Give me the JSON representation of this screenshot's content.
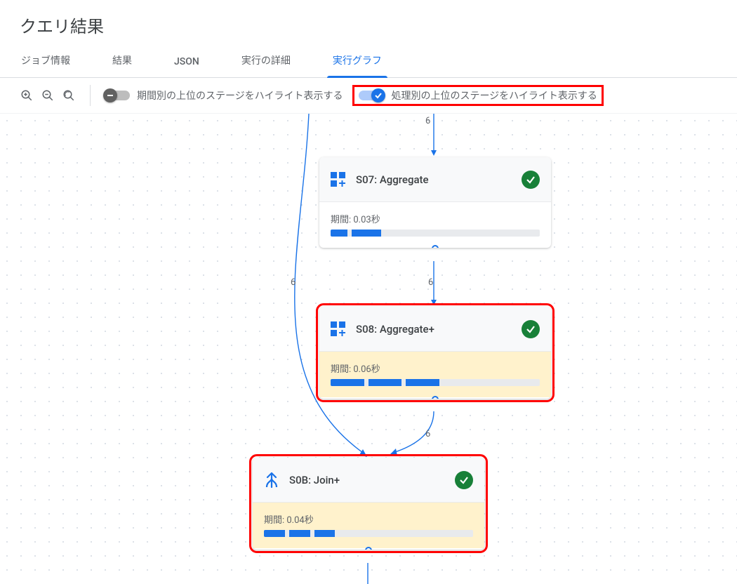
{
  "header": {
    "title": "クエリ結果"
  },
  "tabs": [
    {
      "label": "ジョブ情報",
      "active": false
    },
    {
      "label": "結果",
      "active": false
    },
    {
      "label": "JSON",
      "active": false
    },
    {
      "label": "実行の詳細",
      "active": false
    },
    {
      "label": "実行グラフ",
      "active": true
    }
  ],
  "toolbar": {
    "toggle_duration": {
      "label": "期間別の上位のステージをハイライト表示する",
      "on": false
    },
    "toggle_processing": {
      "label": "処理別の上位のステージをハイライト表示する",
      "on": true
    }
  },
  "graph": {
    "edge_labels": {
      "top_to_s07": "6",
      "s07_to_s08": "6",
      "left_to_s0b": "6",
      "s08_to_s0b": "6"
    },
    "nodes": {
      "s07": {
        "title": "S07: Aggregate",
        "duration_label": "期間: 0.03秒",
        "bar_segments": [
          [
            0,
            8
          ],
          [
            10,
            24
          ]
        ],
        "highlighted": false
      },
      "s08": {
        "title": "S08: Aggregate+",
        "duration_label": "期間: 0.06秒",
        "bar_segments": [
          [
            0,
            16
          ],
          [
            18,
            34
          ],
          [
            36,
            52
          ]
        ],
        "highlighted": true
      },
      "s0b": {
        "title": "S0B: Join+",
        "duration_label": "期間: 0.04秒",
        "bar_segments": [
          [
            0,
            10
          ],
          [
            12,
            22
          ],
          [
            24,
            34
          ]
        ],
        "highlighted": true
      }
    }
  }
}
